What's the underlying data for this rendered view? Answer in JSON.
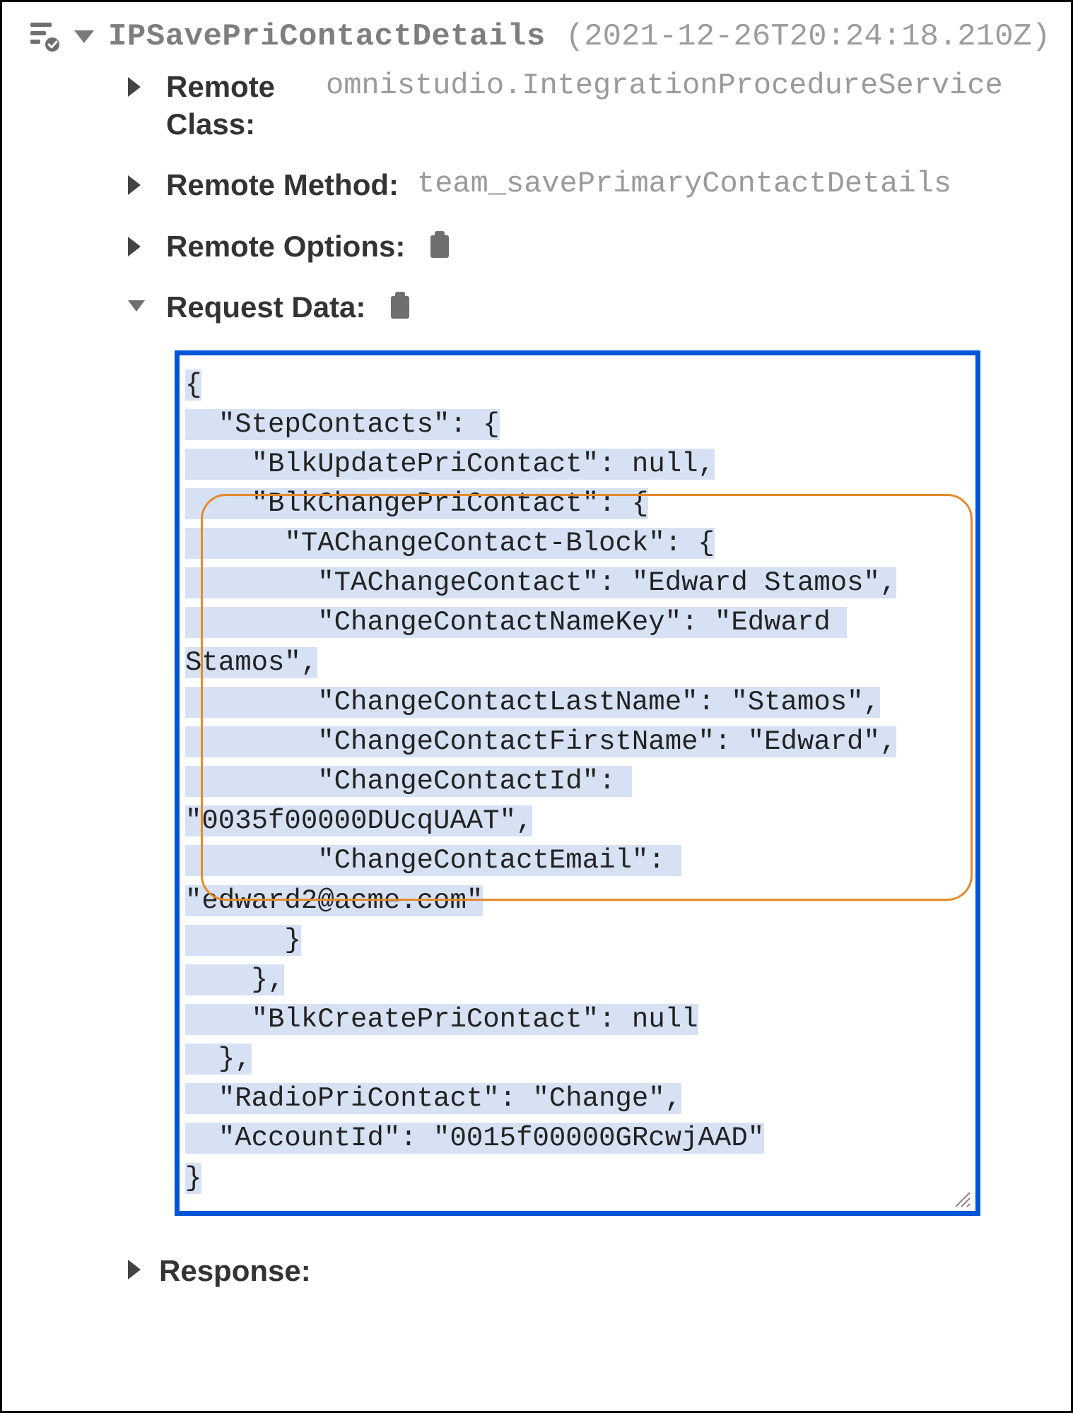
{
  "header": {
    "title": "IPSavePriContactDetails",
    "timestamp": "(2021-12-26T20:24:18.210Z)"
  },
  "props": {
    "remote_class_label": "Remote Class:",
    "remote_class_value": "omnistudio.IntegrationProcedureService",
    "remote_method_label": "Remote Method:",
    "remote_method_value": "team_savePrimaryContactDetails",
    "remote_options_label": "Remote Options:",
    "request_data_label": "Request Data:",
    "response_label": "Response:"
  },
  "request_json": {
    "l01": "{",
    "l02": "  \"StepContacts\": {",
    "l03": "    \"BlkUpdatePriContact\": null,",
    "l04": "    \"BlkChangePriContact\": {",
    "l05": "      \"TAChangeContact-Block\": {",
    "l06": "        \"TAChangeContact\": \"Edward Stamos\",",
    "l07a": "        \"ChangeContactNameKey\": \"Edward ",
    "l07b": "Stamos\",",
    "l08": "        \"ChangeContactLastName\": \"Stamos\",",
    "l09": "        \"ChangeContactFirstName\": \"Edward\",",
    "l10a": "        \"ChangeContactId\": ",
    "l10b": "\"0035f00000DUcqUAAT\",",
    "l11a": "        \"ChangeContactEmail\": ",
    "l11b": "\"edward2@acme.com\"",
    "l12": "      }",
    "l13": "    },",
    "l14": "    \"BlkCreatePriContact\": null",
    "l15": "  },",
    "l16": "  \"RadioPriContact\": \"Change\",",
    "l17": "  \"AccountId\": \"0015f00000GRcwjAAD\"",
    "l18": "}"
  },
  "request_data_raw": {
    "StepContacts": {
      "BlkUpdatePriContact": null,
      "BlkChangePriContact": {
        "TAChangeContact-Block": {
          "TAChangeContact": "Edward Stamos",
          "ChangeContactNameKey": "Edward Stamos",
          "ChangeContactLastName": "Stamos",
          "ChangeContactFirstName": "Edward",
          "ChangeContactId": "0035f00000DUcqUAAT",
          "ChangeContactEmail": "edward2@acme.com"
        }
      },
      "BlkCreatePriContact": null
    },
    "RadioPriContact": "Change",
    "AccountId": "0015f00000GRcwjAAD"
  }
}
